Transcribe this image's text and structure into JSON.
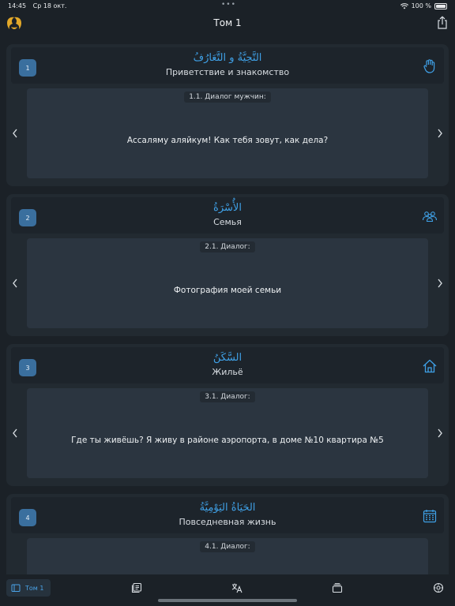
{
  "status": {
    "time": "14:45",
    "date": "Ср 18 окт.",
    "dots": "•••",
    "battery": "100 %"
  },
  "nav": {
    "title": "Том 1"
  },
  "colors": {
    "accent": "#3fa0e6",
    "badge": "#3a6f9e",
    "background": "#1b2127",
    "card": "#222a31",
    "dialog": "#2b3540"
  },
  "cards": [
    {
      "number": "1",
      "arabic": "التَّحِيَّةُ و التَّعَارُفُ",
      "title": "Приветствие и знакомство",
      "icon": "raised-hand-icon",
      "dialog_label": "1.1. Диалог мужчин:",
      "dialog_text": "Ассаляму аляйкум! Как тебя зовут, как дела?"
    },
    {
      "number": "2",
      "arabic": "الأُسْرَةُ",
      "title": "Семья",
      "icon": "family-icon",
      "dialog_label": "2.1. Диалог:",
      "dialog_text": "Фотография моей семьи"
    },
    {
      "number": "3",
      "arabic": "السَّكَنُ",
      "title": "Жильё",
      "icon": "house-icon",
      "dialog_label": "3.1. Диалог:",
      "dialog_text": "Где ты живёшь? Я живу в районе аэропорта, в доме №10 квартира №5"
    },
    {
      "number": "4",
      "arabic": "الحَيَاةُ اليَوْمِيَّةُ",
      "title": "Повседневная жизнь",
      "icon": "calendar-icon",
      "dialog_label": "4.1. Диалог:",
      "dialog_text": ""
    }
  ],
  "tabbar": {
    "active_label": "Том 1"
  }
}
